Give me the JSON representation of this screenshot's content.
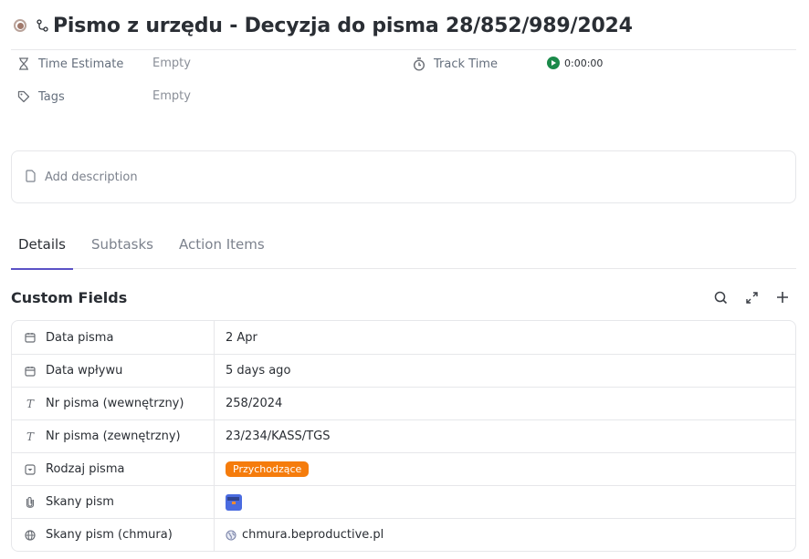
{
  "header": {
    "title": "Pismo z urzędu - Decyzja do pisma 28/852/989/2024",
    "status_color": "#a0786a"
  },
  "meta": {
    "time_estimate": {
      "label": "Time Estimate",
      "value": "Empty",
      "icon": "hourglass-icon"
    },
    "tags": {
      "label": "Tags",
      "value": "Empty",
      "icon": "tag-icon"
    },
    "track_time": {
      "label": "Track Time",
      "value": "0:00:00",
      "icon": "stopwatch-icon"
    }
  },
  "description": {
    "placeholder": "Add description"
  },
  "tabs": [
    {
      "label": "Details",
      "active": true
    },
    {
      "label": "Subtasks",
      "active": false
    },
    {
      "label": "Action Items",
      "active": false
    }
  ],
  "custom_fields": {
    "title": "Custom Fields",
    "actions": [
      "search-icon",
      "expand-icon",
      "plus-icon"
    ],
    "rows": [
      {
        "name": "Data pisma",
        "icon": "calendar-icon",
        "value": "2 Apr"
      },
      {
        "name": "Data wpływu",
        "icon": "calendar-icon",
        "value": "5 days ago"
      },
      {
        "name": "Nr pisma (wewnętrzny)",
        "icon": "text-icon",
        "value": "258/2024"
      },
      {
        "name": "Nr pisma (zewnętrzny)",
        "icon": "text-icon",
        "value": "23/234/KASS/TGS"
      },
      {
        "name": "Rodzaj pisma",
        "icon": "dropdown-icon",
        "value": "Przychodzące",
        "badge_color": "#f57c0c"
      },
      {
        "name": "Skany pism",
        "icon": "paperclip-icon",
        "value": ""
      },
      {
        "name": "Skany pism (chmura)",
        "icon": "globe-icon",
        "value": "chmura.beproductive.pl"
      }
    ]
  }
}
